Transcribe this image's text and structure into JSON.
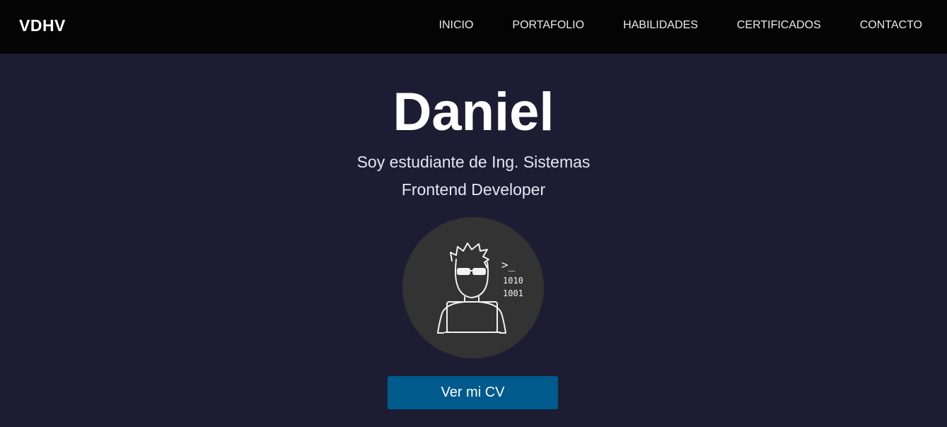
{
  "navbar": {
    "brand": "VDHV",
    "links": [
      {
        "label": "INICIO"
      },
      {
        "label": "PORTAFOLIO"
      },
      {
        "label": "HABILIDADES"
      },
      {
        "label": "CERTIFICADOS"
      },
      {
        "label": "CONTACTO"
      }
    ]
  },
  "hero": {
    "name": "Daniel",
    "subtitle1": "Soy estudiante de Ing. Sistemas",
    "subtitle2": "Frontend Developer",
    "avatar": {
      "icon": "developer-laptop-icon",
      "terminal_prompt": ">_",
      "binary_line1": "1010",
      "binary_line2": "1001"
    },
    "cv_button": "Ver mi CV"
  },
  "colors": {
    "navbar_bg": "#040404",
    "page_bg": "#1c1c33",
    "avatar_bg": "#333333",
    "button_bg": "#005a8c",
    "text": "#ffffff"
  }
}
